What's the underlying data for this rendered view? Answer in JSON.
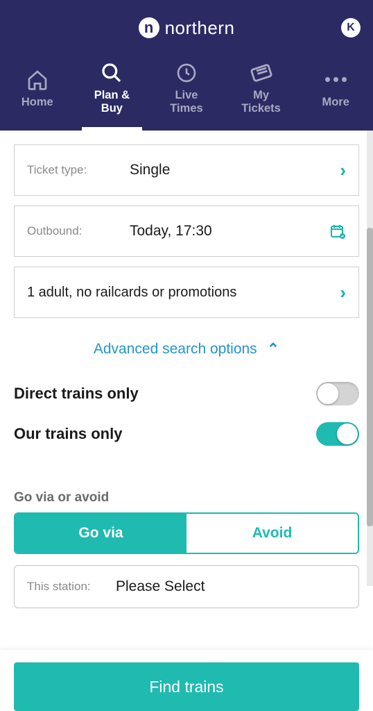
{
  "brand": {
    "mark_letter": "n",
    "wordmark": "northern"
  },
  "avatar_initial": "K",
  "tabs": [
    {
      "label": "Home"
    },
    {
      "label": "Plan &\nBuy"
    },
    {
      "label": "Live\nTimes"
    },
    {
      "label": "My\nTickets"
    },
    {
      "label": "More"
    }
  ],
  "ticket_type": {
    "label": "Ticket type:",
    "value": "Single"
  },
  "outbound": {
    "label": "Outbound:",
    "value": "Today, 17:30"
  },
  "passengers": {
    "value": "1 adult, no railcards or promotions"
  },
  "advanced_label": "Advanced search options",
  "toggles": {
    "direct": {
      "label": "Direct trains only",
      "on": false
    },
    "our_trains": {
      "label": "Our trains only",
      "on": true
    }
  },
  "via_avoid": {
    "section_label": "Go via or avoid",
    "go_via": "Go via",
    "avoid": "Avoid",
    "station_label": "This station:",
    "station_value": "Please Select"
  },
  "find_label": "Find trains",
  "colors": {
    "primary": "#2b2a63",
    "accent": "#1fbab0",
    "link": "#2196c9"
  }
}
